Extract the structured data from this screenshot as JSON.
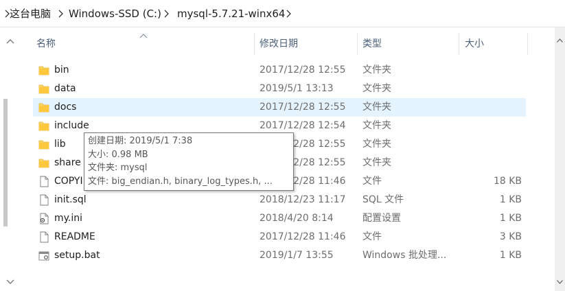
{
  "address": {
    "crumbs": [
      "这台电脑",
      "Windows-SSD (C:)",
      "mysql-5.7.21-winx64"
    ]
  },
  "columns": {
    "name": "名称",
    "date": "修改日期",
    "type": "类型",
    "size": "大小"
  },
  "rows": [
    {
      "name": "bin",
      "date": "2017/12/28 12:55",
      "type": "文件夹",
      "size": "",
      "icon": "folder-icon"
    },
    {
      "name": "data",
      "date": "2019/5/1 13:13",
      "type": "文件夹",
      "size": "",
      "icon": "folder-icon"
    },
    {
      "name": "docs",
      "date": "2017/12/28 12:55",
      "type": "文件夹",
      "size": "",
      "icon": "folder-icon"
    },
    {
      "name": "include",
      "date": "2017/12/28 12:54",
      "type": "文件夹",
      "size": "",
      "icon": "folder-icon"
    },
    {
      "name": "lib",
      "date": "2017/12/28 12:55",
      "type": "文件夹",
      "size": "",
      "icon": "folder-icon"
    },
    {
      "name": "share",
      "date": "2017/12/28 12:55",
      "type": "文件夹",
      "size": "",
      "icon": "folder-icon"
    },
    {
      "name": "COPYING",
      "date": "2017/12/28 11:46",
      "type": "文件",
      "size": "18 KB",
      "icon": "file-icon"
    },
    {
      "name": "init.sql",
      "date": "2018/12/23 11:17",
      "type": "SQL 文件",
      "size": "1 KB",
      "icon": "file-icon"
    },
    {
      "name": "my.ini",
      "date": "2018/4/20 8:14",
      "type": "配置设置",
      "size": "1 KB",
      "icon": "settings-file-icon"
    },
    {
      "name": "README",
      "date": "2017/12/28 11:46",
      "type": "文件",
      "size": "3 KB",
      "icon": "file-icon"
    },
    {
      "name": "setup.bat",
      "date": "2019/1/7 13:55",
      "type": "Windows 批处理...",
      "size": "1 KB",
      "icon": "batch-file-icon"
    }
  ],
  "selected_row": "docs",
  "tooltip": {
    "line1": "创建日期: 2019/5/1 7:38",
    "line2": "大小: 0.98 MB",
    "line3": "文件夹: mysql",
    "line4": "文件: big_endian.h, binary_log_types.h, ..."
  },
  "colors": {
    "selection": "#e5f3ff",
    "folder": "#ffd766",
    "header_text": "#4c607a"
  }
}
